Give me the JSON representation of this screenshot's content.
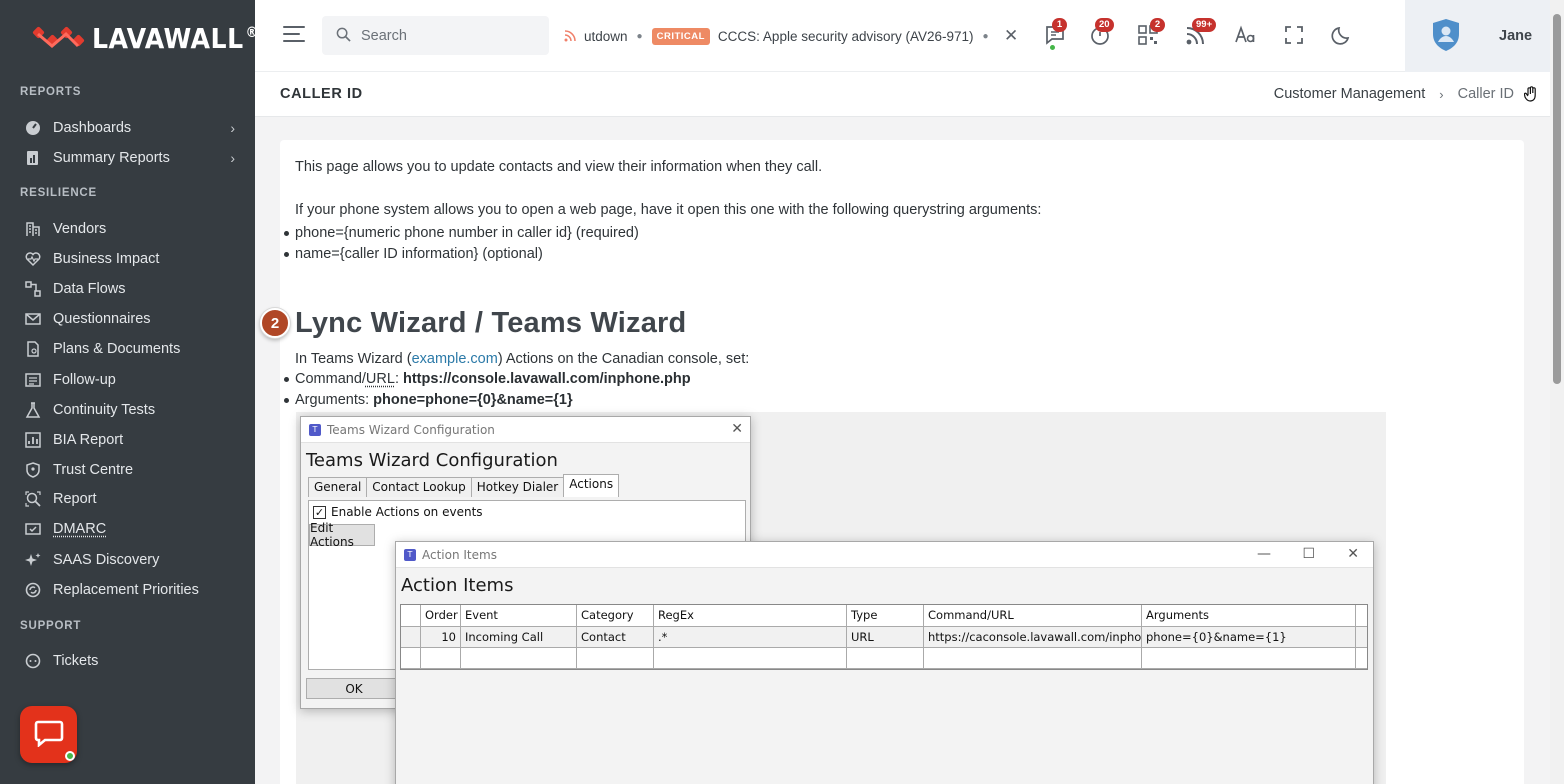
{
  "brand": {
    "name": "LAVAWALL",
    "reg": "®"
  },
  "sidebar": {
    "sections": [
      {
        "title": "REPORTS",
        "items": [
          {
            "label": "Dashboards",
            "icon": "dashboard-icon",
            "chevron": true
          },
          {
            "label": "Summary Reports",
            "icon": "report-chart-icon",
            "chevron": true
          }
        ]
      },
      {
        "title": "RESILIENCE",
        "items": [
          {
            "label": "Vendors",
            "icon": "building-icon"
          },
          {
            "label": "Business Impact",
            "icon": "heart-pulse-icon"
          },
          {
            "label": "Data Flows",
            "icon": "flow-icon"
          },
          {
            "label": "Questionnaires",
            "icon": "envelope-icon"
          },
          {
            "label": "Plans & Documents",
            "icon": "document-icon"
          },
          {
            "label": "Follow-up",
            "icon": "list-icon"
          },
          {
            "label": "Continuity Tests",
            "icon": "flask-icon"
          },
          {
            "label": "BIA Report",
            "icon": "chart-icon"
          },
          {
            "label": "Trust Centre",
            "icon": "shield-icon"
          },
          {
            "label": "Report",
            "icon": "search-report-icon"
          },
          {
            "label": "DMARC",
            "icon": "mail-check-icon"
          },
          {
            "label": "SAAS Discovery",
            "icon": "sparkle-icon"
          },
          {
            "label": "Replacement Priorities",
            "icon": "cycle-icon"
          }
        ]
      },
      {
        "title": "SUPPORT",
        "items": [
          {
            "label": "Tickets",
            "icon": "headset-icon"
          }
        ]
      }
    ]
  },
  "topbar": {
    "search_placeholder": "Search",
    "ticker": {
      "fragment": "utdown",
      "badge": "CRITICAL",
      "headline": "CCCS: Apple security advisory (AV26-971)"
    },
    "badges": {
      "messages": "1",
      "timer": "20",
      "qr": "2",
      "rss": "99+"
    },
    "user": "Jane"
  },
  "page": {
    "title": "CALLER ID",
    "breadcrumb": {
      "parent": "Customer Management",
      "current": "Caller ID"
    }
  },
  "content": {
    "intro": "This page allows you to update contacts and view their information when they call.",
    "intro2": "If your phone system allows you to open a web page, have it open this one with the following querystring arguments:",
    "args": [
      "phone={numeric phone number in caller id} (required)",
      "name={caller ID information} (optional)"
    ],
    "step": "2",
    "wizard_heading": "Lync Wizard / Teams Wizard",
    "wizard_intro_pre": "In Teams Wizard (",
    "wizard_link": "example.com",
    "wizard_intro_post": ") Actions on the Canadian console, set:",
    "command_label_pre": "Command/",
    "command_label_abbr": "URL",
    "command_label_post": ": ",
    "command_value": "https://console.lavawall.com/inphone.php",
    "arguments_label": "Arguments: ",
    "arguments_value": "phone=phone={0}&name={1}"
  },
  "screenshot": {
    "config_window": {
      "title": "Teams Wizard Configuration",
      "heading": "Teams Wizard Configuration",
      "tabs": [
        "General",
        "Contact Lookup",
        "Hotkey Dialer",
        "Actions"
      ],
      "active_tab": "Actions",
      "checkbox_label": "Enable Actions on events",
      "checkbox_checked": true,
      "edit_button": "Edit Actions",
      "ok_button": "OK"
    },
    "action_window": {
      "title": "Action Items",
      "heading": "Action Items",
      "columns": [
        "Order",
        "Event",
        "Category",
        "RegEx",
        "Type",
        "Command/URL",
        "Arguments"
      ],
      "rows": [
        [
          "10",
          "Incoming Call",
          "Contact",
          ".*",
          "URL",
          "https://caconsole.lavawall.com/inphone.p",
          "phone={0}&name={1}"
        ]
      ]
    }
  },
  "colors": {
    "sidebar": "#363c41",
    "accent": "#e3321b",
    "critical": "#ee8a64",
    "badge": "#c6322d",
    "step": "#b04726"
  }
}
